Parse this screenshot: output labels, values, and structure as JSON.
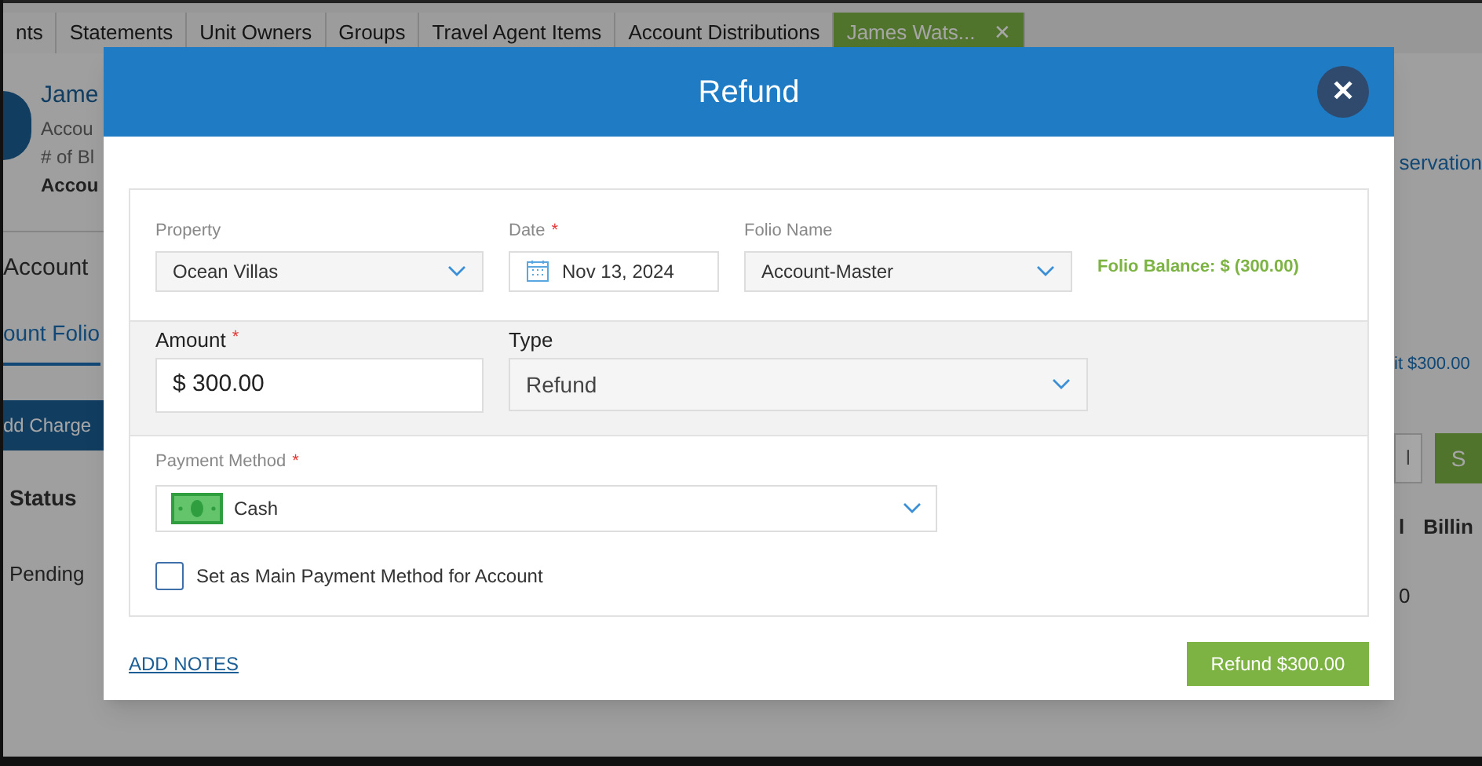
{
  "background": {
    "tabs": [
      {
        "label": "nts",
        "selected": false
      },
      {
        "label": "Statements",
        "selected": false
      },
      {
        "label": "Unit Owners",
        "selected": false
      },
      {
        "label": "Groups",
        "selected": false
      },
      {
        "label": "Travel Agent Items",
        "selected": false
      },
      {
        "label": "Account Distributions",
        "selected": false
      },
      {
        "label": "James Wats...",
        "selected": true,
        "close": "✕"
      }
    ],
    "left": {
      "name": "Jame",
      "line_1": "Accou",
      "line_2": "# of Bl",
      "line_3": "Accou",
      "section": "Account",
      "folio_tab": "ount Folio",
      "add_charge": "dd Charge",
      "status_header": "Status",
      "status": "Pending"
    },
    "right": {
      "link": "servation",
      "credit": "it $300.00",
      "button_1": "l",
      "button_2": "S",
      "column_1": "l",
      "column_2": "Billin",
      "cell": "0"
    }
  },
  "dialog": {
    "title": "Refund",
    "close": "✕",
    "required_mark": "*",
    "property": {
      "label": "Property",
      "value": "Ocean Villas"
    },
    "date": {
      "label": "Date",
      "required": true,
      "value": "Nov 13, 2024"
    },
    "folio": {
      "label": "Folio Name",
      "value": "Account-Master"
    },
    "folio_balance": "Folio Balance: $ (300.00)",
    "amount": {
      "label": "Amount",
      "required": true,
      "value": "$ 300.00"
    },
    "type": {
      "label": "Type",
      "value": "Refund"
    },
    "payment_method": {
      "label": "Payment Method",
      "required": true,
      "value": "Cash"
    },
    "main_method": {
      "label": "Set as Main Payment Method for Account",
      "checked": false
    },
    "add_notes": "ADD NOTES",
    "submit": "Refund $300.00"
  }
}
